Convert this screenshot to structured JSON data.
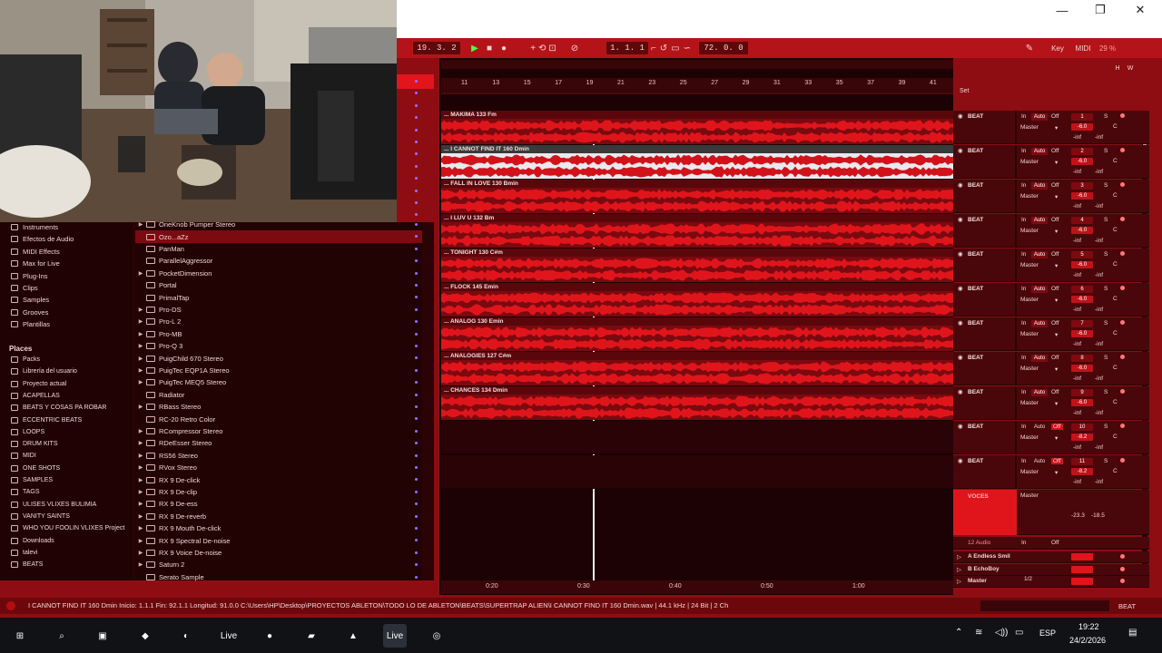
{
  "window": {
    "minimize": "—",
    "maximize": "❐",
    "close": "✕"
  },
  "transport": {
    "position": "19.  3.  2",
    "loop_start": "1.  1.  1",
    "tempo_display": "72.  0.  0",
    "key_label": "Key",
    "midi_label": "MIDI",
    "cpu": "29 %",
    "h_label": "H",
    "w_label": "W"
  },
  "browser": {
    "categories": [
      {
        "label": "Instruments",
        "icon": "instruments-icon"
      },
      {
        "label": "Efectos de Audio",
        "icon": "audio-effects-icon"
      },
      {
        "label": "MIDI Effects",
        "icon": "midi-effects-icon"
      },
      {
        "label": "Max for Live",
        "icon": "max-icon"
      },
      {
        "label": "Plug-Ins",
        "icon": "plugins-icon"
      },
      {
        "label": "Clips",
        "icon": "clips-icon"
      },
      {
        "label": "Samples",
        "icon": "samples-icon"
      },
      {
        "label": "Grooves",
        "icon": "grooves-icon"
      },
      {
        "label": "Plantillas",
        "icon": "templates-icon"
      }
    ],
    "places_header": "Places",
    "places": [
      "Packs",
      "Librería del usuario",
      "Proyecto actual",
      "ACAPELLAS",
      "BEATS Y COSAS PA ROBAR",
      "ECCENTRIC BEATS",
      "LOOPS",
      "DRUM KITS",
      "MIDI",
      "ONE SHOTS",
      "SAMPLES",
      "TAGS",
      "ULISES VLIXES BULIMIA",
      "VANITY SAINTS",
      "WHO YOU FOOLIN VLIXES Project",
      "Downloads",
      "talevi",
      "BEATS"
    ],
    "files": [
      {
        "label": "OneKnob Pumper Stereo",
        "folder": true
      },
      {
        "label": "Ozo...aZz",
        "folder": false,
        "selected": true
      },
      {
        "label": "PanMan",
        "folder": false
      },
      {
        "label": "ParallelAggressor",
        "folder": false
      },
      {
        "label": "PocketDimension",
        "folder": true
      },
      {
        "label": "Portal",
        "folder": false
      },
      {
        "label": "PrimalTap",
        "folder": false
      },
      {
        "label": "Pro-DS",
        "folder": true
      },
      {
        "label": "Pro-L 2",
        "folder": true
      },
      {
        "label": "Pro-MB",
        "folder": true
      },
      {
        "label": "Pro-Q 3",
        "folder": true
      },
      {
        "label": "PuigChild 670 Stereo",
        "folder": true
      },
      {
        "label": "PuigTec EQP1A Stereo",
        "folder": true
      },
      {
        "label": "PuigTec MEQ5 Stereo",
        "folder": true
      },
      {
        "label": "Radiator",
        "folder": false
      },
      {
        "label": "RBass Stereo",
        "folder": true
      },
      {
        "label": "RC-20 Retro Color",
        "folder": false
      },
      {
        "label": "RCompressor Stereo",
        "folder": true
      },
      {
        "label": "RDeEsser Stereo",
        "folder": true
      },
      {
        "label": "RS56 Stereo",
        "folder": true
      },
      {
        "label": "RVox Stereo",
        "folder": true
      },
      {
        "label": "RX 9 De-click",
        "folder": true
      },
      {
        "label": "RX 9 De-clip",
        "folder": true
      },
      {
        "label": "RX 9 De-ess",
        "folder": true
      },
      {
        "label": "RX 9 De-reverb",
        "folder": true
      },
      {
        "label": "RX 9 Mouth De-click",
        "folder": true
      },
      {
        "label": "RX 9 Spectral De-noise",
        "folder": true
      },
      {
        "label": "RX 9 Voice De-noise",
        "folder": true
      },
      {
        "label": "Saturn 2",
        "folder": true
      },
      {
        "label": "Serato Sample",
        "folder": false
      }
    ]
  },
  "ruler": {
    "bars": [
      "11",
      "13",
      "15",
      "17",
      "19",
      "21",
      "23",
      "25",
      "27",
      "29",
      "31",
      "33",
      "35",
      "37",
      "39",
      "41"
    ],
    "set_label": "Set",
    "time_marks": [
      "0:20",
      "0:30",
      "0:40",
      "0:50",
      "1:00"
    ]
  },
  "tracks": [
    {
      "clip": "... MAKIMA 133 Fm",
      "name": "BEAT",
      "vol": "-6.0",
      "num": "1",
      "selected": false
    },
    {
      "clip": "... I CANNOT FIND IT 160 Dmin",
      "name": "BEAT",
      "vol": "-6.0",
      "num": "2",
      "selected": true
    },
    {
      "clip": "... FALL IN LOVE 130 Bmin",
      "name": "BEAT",
      "vol": "-6.0",
      "num": "3",
      "selected": false
    },
    {
      "clip": "... I LUV U 132 Bm",
      "name": "BEAT",
      "vol": "-6.0",
      "num": "4",
      "selected": false
    },
    {
      "clip": "... TONIGHT 130 C#m",
      "name": "BEAT",
      "vol": "-6.0",
      "num": "5",
      "selected": false
    },
    {
      "clip": "... FLOCK 145 Emin",
      "name": "BEAT",
      "vol": "-6.0",
      "num": "6",
      "selected": false
    },
    {
      "clip": "... ANALOG 130 Emin",
      "name": "BEAT",
      "vol": "-6.0",
      "num": "7",
      "selected": false
    },
    {
      "clip": "... ANALOGIES 127 C#m",
      "name": "BEAT",
      "vol": "-6.0",
      "num": "8",
      "selected": false
    },
    {
      "clip": "... CHANCES 134 Dmin",
      "name": "BEAT",
      "vol": "-6.0",
      "num": "9",
      "selected": false
    },
    {
      "clip": "",
      "name": "BEAT",
      "vol": "-8.2",
      "num": "10",
      "selected": false
    },
    {
      "clip": "",
      "name": "BEAT",
      "vol": "-8.2",
      "num": "11",
      "selected": false
    }
  ],
  "mixer": {
    "in_label": "In",
    "auto_label": "Auto",
    "off_label": "Off",
    "master_label": "Master",
    "s_label": "S",
    "c_label": "C",
    "inf": "-inf",
    "vocals_name": "VOCES",
    "vocals_vals": [
      "-23.3",
      "-18.5"
    ],
    "audio_name": "12 Audio",
    "returns": [
      "A Endless Smil",
      "B EchoBoy",
      "Master"
    ],
    "master_io": "1/2"
  },
  "status": {
    "text": "I CANNOT FIND IT 160 Dmin  Inicio: 1.1.1  Fin: 92.1.1  Longitud: 91.0.0  C:\\Users\\HP\\Desktop\\PROYECTOS ABLETON\\TODO LO DE ABLETON\\BEATS\\SUPERTRAP ALIEN\\I CANNOT FIND IT 160 Dmin.wav | 44.1 kHz | 24 Bit | 2 Ch",
    "track_name": "BEAT"
  },
  "taskbar": {
    "apps": [
      {
        "name": "windows-start-icon"
      },
      {
        "name": "search-icon"
      },
      {
        "name": "task-view-icon"
      },
      {
        "name": "copilot-icon"
      },
      {
        "name": "fl-studio-icon"
      },
      {
        "name": "ableton-live-pin-icon",
        "label": "Live"
      },
      {
        "name": "spotify-icon"
      },
      {
        "name": "file-explorer-icon"
      },
      {
        "name": "brave-icon"
      },
      {
        "name": "ableton-live-running-icon",
        "label": "Live"
      },
      {
        "name": "obs-icon"
      }
    ],
    "lang": "ESP",
    "time": "19:22",
    "date": "24/2/2026"
  },
  "colors": {
    "accent": "#e0151c",
    "clip": "#c0121a",
    "bg": "#8e0d12",
    "waveform_selected": "#ffffff"
  }
}
